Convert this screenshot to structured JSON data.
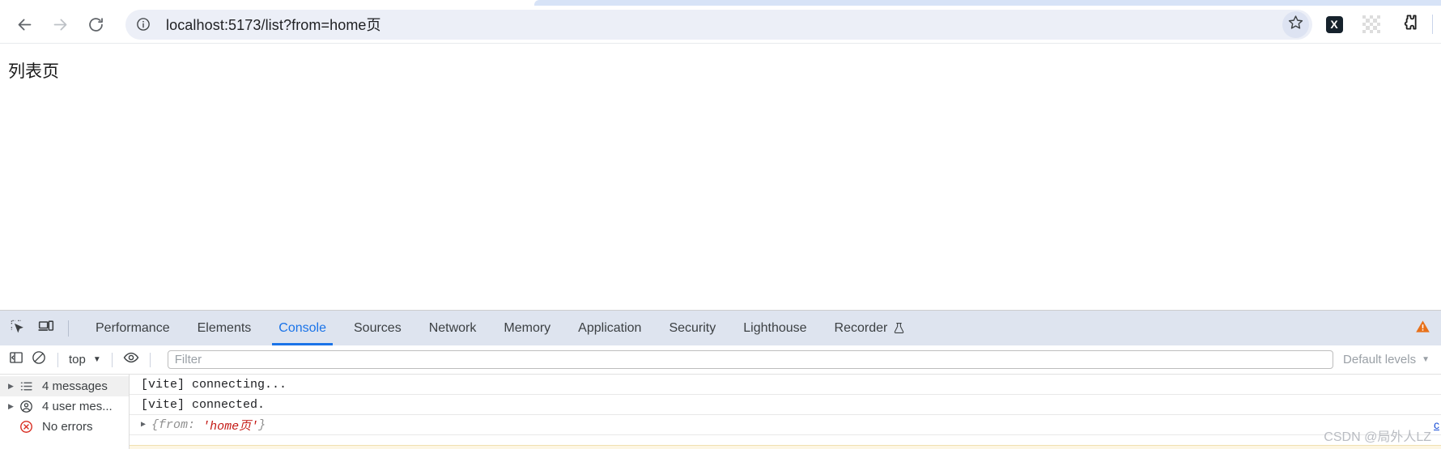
{
  "browser": {
    "nav": {
      "back_icon": "arrow-left-icon",
      "forward_icon": "arrow-right-icon",
      "reload_icon": "reload-icon"
    },
    "omnibox": {
      "site_info_icon": "info-circle-icon",
      "url": "localhost:5173/list?from=home页",
      "bookmark_icon": "star-icon"
    },
    "extensions": [
      {
        "name": "x-extension",
        "label": "X",
        "icon": "x-extension-icon"
      },
      {
        "name": "grid-extension",
        "label": "",
        "icon": "grid-extension-icon"
      },
      {
        "name": "extensions-menu",
        "label": "",
        "icon": "puzzle-piece-icon"
      }
    ]
  },
  "page": {
    "heading": "列表页"
  },
  "devtools": {
    "tool_icons": [
      {
        "name": "inspect-element",
        "icon": "inspect-cursor-icon"
      },
      {
        "name": "device-toolbar",
        "icon": "device-toolbar-icon"
      }
    ],
    "tabs": [
      {
        "label": "Performance",
        "active": false
      },
      {
        "label": "Elements",
        "active": false
      },
      {
        "label": "Console",
        "active": true
      },
      {
        "label": "Sources",
        "active": false
      },
      {
        "label": "Network",
        "active": false
      },
      {
        "label": "Memory",
        "active": false
      },
      {
        "label": "Application",
        "active": false
      },
      {
        "label": "Security",
        "active": false
      },
      {
        "label": "Lighthouse",
        "active": false
      },
      {
        "label": "Recorder",
        "active": false,
        "icon": "beaker-icon"
      }
    ],
    "warning_badge_icon": "warning-triangle-icon",
    "console_toolbar": {
      "sidebar_toggle_icon": "sidebar-toggle-icon",
      "clear_console_icon": "clear-console-icon",
      "context": "top",
      "context_caret": "▼",
      "live_expression_icon": "eye-icon",
      "filter_placeholder": "Filter",
      "filter_value": "",
      "levels": "Default levels",
      "levels_caret": "▼"
    },
    "sidebar": [
      {
        "label": "4 messages",
        "icon": "list-icon",
        "twisty": "▶",
        "selected": true
      },
      {
        "label": "4 user mes...",
        "icon": "user-circle-icon",
        "twisty": "▶",
        "selected": false
      },
      {
        "label": "No errors",
        "icon": "error-circle-icon",
        "twisty": "",
        "selected": false
      }
    ],
    "messages": [
      {
        "text": "[vite] connecting...",
        "type": "plain",
        "source": ""
      },
      {
        "text": "[vite] connected.",
        "type": "plain",
        "source": ""
      },
      {
        "type": "object",
        "twisty": "▶",
        "open_brace": "{",
        "key": "from:",
        "value": "'home页'",
        "close_brace": "}",
        "source": "c"
      }
    ]
  },
  "watermark": "CSDN @局外人LZ",
  "colors": {
    "accent": "#1a73e8",
    "omnibox_bg": "#eceff7",
    "devtools_tabbar_bg": "#dee4ef",
    "string_red": "#c41a16",
    "warning_orange": "#e8711a",
    "error_red": "#d93025"
  }
}
